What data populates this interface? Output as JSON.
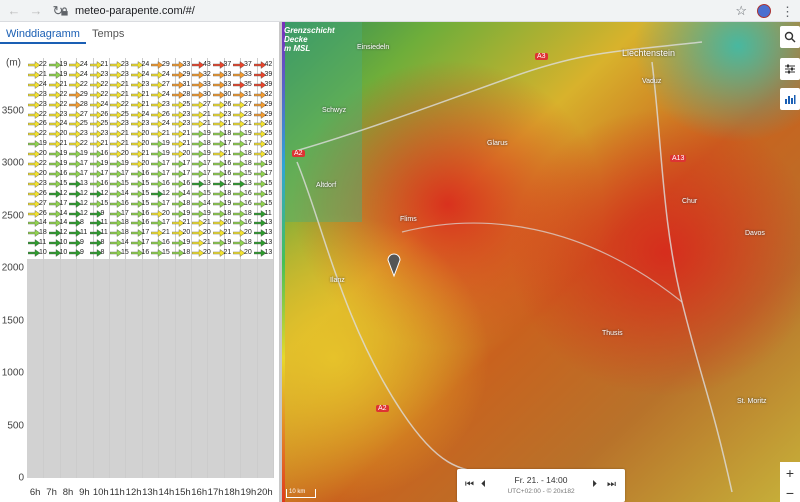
{
  "browser": {
    "url": "meteo-parapente.com/#/",
    "back_icon": "arrow-left-icon",
    "forward_icon": "arrow-right-icon",
    "reload_icon": "reload-icon"
  },
  "tabs": [
    {
      "label": "Winddiagramm",
      "active": true
    },
    {
      "label": "Temps",
      "active": false
    }
  ],
  "wind_chart": {
    "y_unit": "(m)",
    "y_labels": [
      "3500",
      "3000",
      "2500",
      "2000",
      "1500",
      "1000",
      "500",
      "0"
    ],
    "hours": [
      "6h",
      "7h",
      "8h",
      "9h",
      "10h",
      "11h",
      "12h",
      "13h",
      "14h",
      "15h",
      "16h",
      "17h",
      "18h",
      "19h",
      "20h"
    ],
    "rows": [
      [
        "22",
        "19",
        "24",
        "21",
        "23",
        "24",
        "29",
        "33",
        "43",
        "37",
        "37",
        "42"
      ],
      [
        "21",
        "19",
        "24",
        "23",
        "23",
        "24",
        "24",
        "29",
        "32",
        "33",
        "33",
        "39"
      ],
      [
        "24",
        "21",
        "22",
        "22",
        "21",
        "23",
        "27",
        "31",
        "33",
        "33",
        "35",
        "39"
      ],
      [
        "23",
        "22",
        "29",
        "22",
        "21",
        "21",
        "24",
        "28",
        "30",
        "30",
        "31",
        "32"
      ],
      [
        "23",
        "22",
        "28",
        "24",
        "22",
        "21",
        "23",
        "25",
        "27",
        "26",
        "27",
        "29"
      ],
      [
        "22",
        "23",
        "27",
        "26",
        "25",
        "24",
        "26",
        "23",
        "21",
        "23",
        "23",
        "29"
      ],
      [
        "26",
        "24",
        "25",
        "25",
        "23",
        "23",
        "24",
        "23",
        "21",
        "21",
        "21",
        "26"
      ],
      [
        "22",
        "20",
        "23",
        "23",
        "21",
        "20",
        "21",
        "21",
        "19",
        "18",
        "19",
        "25"
      ],
      [
        "19",
        "21",
        "22",
        "21",
        "21",
        "20",
        "19",
        "21",
        "18",
        "17",
        "17",
        "20"
      ],
      [
        "20",
        "19",
        "19",
        "16",
        "20",
        "21",
        "19",
        "20",
        "19",
        "21",
        "18",
        "20"
      ],
      [
        "22",
        "19",
        "17",
        "19",
        "19",
        "20",
        "17",
        "17",
        "17",
        "16",
        "18",
        "19"
      ],
      [
        "20",
        "16",
        "17",
        "17",
        "17",
        "16",
        "17",
        "17",
        "17",
        "16",
        "15",
        "17"
      ],
      [
        "23",
        "15",
        "13",
        "16",
        "15",
        "15",
        "16",
        "16",
        "13",
        "12",
        "13",
        "15"
      ],
      [
        "26",
        "12",
        "12",
        "12",
        "14",
        "15",
        "12",
        "14",
        "15",
        "18",
        "16",
        "15"
      ],
      [
        "27",
        "17",
        "12",
        "15",
        "16",
        "15",
        "17",
        "18",
        "14",
        "19",
        "16",
        "15"
      ],
      [
        "26",
        "14",
        "12",
        "9",
        "17",
        "16",
        "20",
        "19",
        "19",
        "18",
        "18",
        "11"
      ],
      [
        "14",
        "14",
        "8",
        "11",
        "18",
        "16",
        "17",
        "21",
        "21",
        "20",
        "16",
        "13"
      ],
      [
        "18",
        "12",
        "11",
        "11",
        "18",
        "17",
        "21",
        "20",
        "20",
        "21",
        "20",
        "13"
      ],
      [
        "11",
        "10",
        "9",
        "8",
        "14",
        "17",
        "16",
        "19",
        "21",
        "19",
        "18",
        "13"
      ],
      [
        "10",
        "10",
        "9",
        "8",
        "15",
        "16",
        "15",
        "18",
        "20",
        "21",
        "20",
        "13"
      ]
    ],
    "colors": {
      "green": "#2e9b2e",
      "lightgreen": "#8fd14f",
      "yellow": "#f2e130",
      "orange": "#f29b30",
      "red": "#e8452c"
    }
  },
  "map": {
    "legend_lines": [
      "Grenzschicht",
      "Decke",
      "m MSL"
    ],
    "labels": [
      {
        "text": "Einsiedeln"
      },
      {
        "text": "Schwyz"
      },
      {
        "text": "Glarus"
      },
      {
        "text": "Liechtenstein"
      },
      {
        "text": "Vaduz"
      },
      {
        "text": "Chur"
      },
      {
        "text": "Davos"
      },
      {
        "text": "Flims"
      },
      {
        "text": "Ilanz"
      },
      {
        "text": "Thusis"
      },
      {
        "text": "St. Moritz"
      },
      {
        "text": "Altdorf"
      }
    ],
    "roads": [
      "A3",
      "A2",
      "A13",
      "A2"
    ],
    "scale_label": "10 km",
    "side_buttons": [
      "search-icon",
      "sliders-icon",
      "chart-icon"
    ],
    "zoom_in": "+",
    "zoom_out": "−",
    "time": {
      "label": "Fr. 21. - 14:00",
      "sub": "UTC+02:00 - © 20x182",
      "first_icon": "skip-first-icon",
      "prev_icon": "step-back-icon",
      "next_icon": "step-forward-icon",
      "last_icon": "skip-last-icon"
    }
  }
}
